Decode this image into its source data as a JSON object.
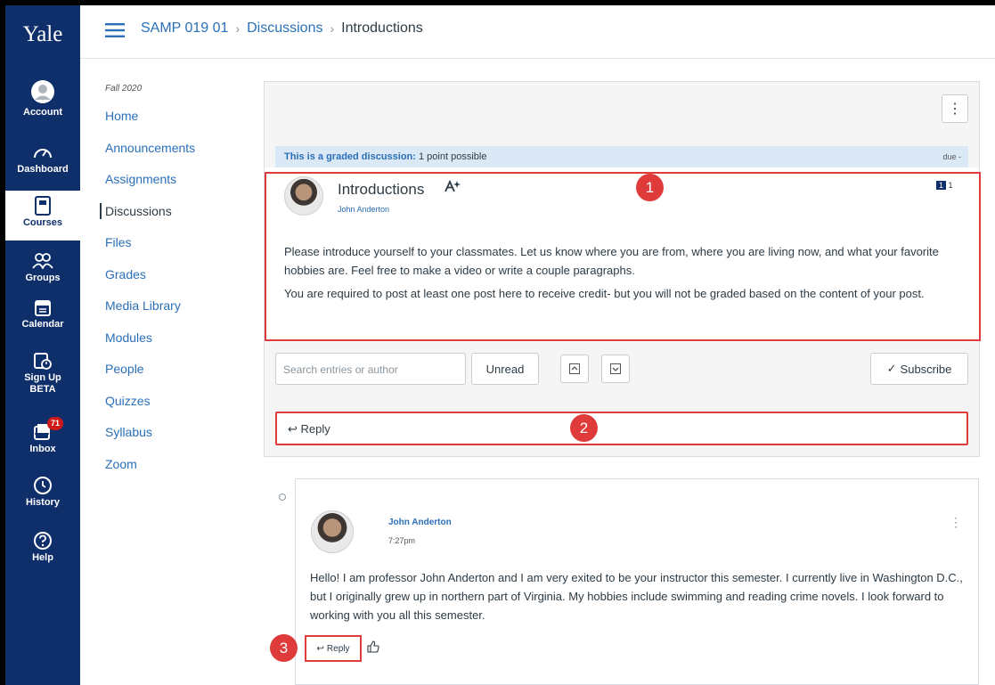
{
  "nav": {
    "logo": "Yale",
    "items": [
      {
        "label": "Account",
        "icon": "account-icon"
      },
      {
        "label": "Dashboard",
        "icon": "dashboard-icon"
      },
      {
        "label": "Courses",
        "icon": "courses-icon"
      },
      {
        "label": "Groups",
        "icon": "groups-icon"
      },
      {
        "label": "Calendar",
        "icon": "calendar-icon"
      },
      {
        "label": "Sign Up",
        "label2": "BETA",
        "icon": "signup-icon"
      },
      {
        "label": "Inbox",
        "icon": "inbox-icon",
        "badge": "71"
      },
      {
        "label": "History",
        "icon": "history-icon"
      },
      {
        "label": "Help",
        "icon": "help-icon"
      }
    ]
  },
  "breadcrumb": {
    "course": "SAMP 019 01",
    "section": "Discussions",
    "current": "Introductions"
  },
  "course_nav": {
    "term": "Fall 2020",
    "items": [
      "Home",
      "Announcements",
      "Assignments",
      "Discussions",
      "Files",
      "Grades",
      "Media Library",
      "Modules",
      "People",
      "Quizzes",
      "Syllabus",
      "Zoom"
    ]
  },
  "discussion": {
    "graded_label": "This is a graded discussion:",
    "graded_points": "1 point possible",
    "due": "due -",
    "title": "Introductions",
    "author": "John Anderton",
    "count_badge": "1",
    "count_total": "1",
    "paragraphs": [
      "Please introduce yourself to your classmates.  Let us know where you are from, where you are living now, and what your favorite hobbies are.  Feel free to make a video or write a couple paragraphs.",
      "You are required to post at least one post here to receive credit- but you will not be graded based on the content of your post."
    ],
    "search_placeholder": "Search entries or author",
    "unread_label": "Unread",
    "subscribe_label": "Subscribe",
    "reply_label": "Reply"
  },
  "entry": {
    "author": "John Anderton",
    "time": "7:27pm",
    "text": "Hello!  I am professor John Anderton and I am very exited to be your instructor this semester.  I currently live in Washington D.C., but I originally grew up in northern part of Virginia.  My hobbies include swimming and reading crime novels.  I look forward to working with you all this semester.",
    "reply_label": "Reply"
  },
  "callouts": [
    "1",
    "2",
    "3"
  ],
  "colors": {
    "nav": "#0f2f6b",
    "link": "#2a6fb8",
    "highlight": "#e03b3b",
    "graded_bar": "#dbe9f7"
  }
}
